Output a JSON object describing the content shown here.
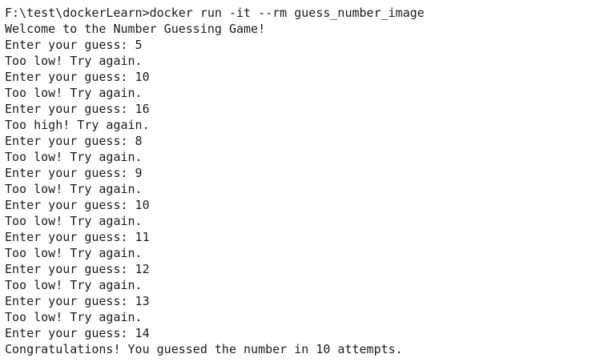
{
  "terminal": {
    "lines": [
      "F:\\test\\dockerLearn>docker run -it --rm guess_number_image",
      "Welcome to the Number Guessing Game!",
      "Enter your guess: 5",
      "Too low! Try again.",
      "Enter your guess: 10",
      "Too low! Try again.",
      "Enter your guess: 16",
      "Too high! Try again.",
      "Enter your guess: 8",
      "Too low! Try again.",
      "Enter your guess: 9",
      "Too low! Try again.",
      "Enter your guess: 10",
      "Too low! Try again.",
      "Enter your guess: 11",
      "Too low! Try again.",
      "Enter your guess: 12",
      "Too low! Try again.",
      "Enter your guess: 13",
      "Too low! Try again.",
      "Enter your guess: 14",
      "Congratulations! You guessed the number in 10 attempts."
    ]
  }
}
